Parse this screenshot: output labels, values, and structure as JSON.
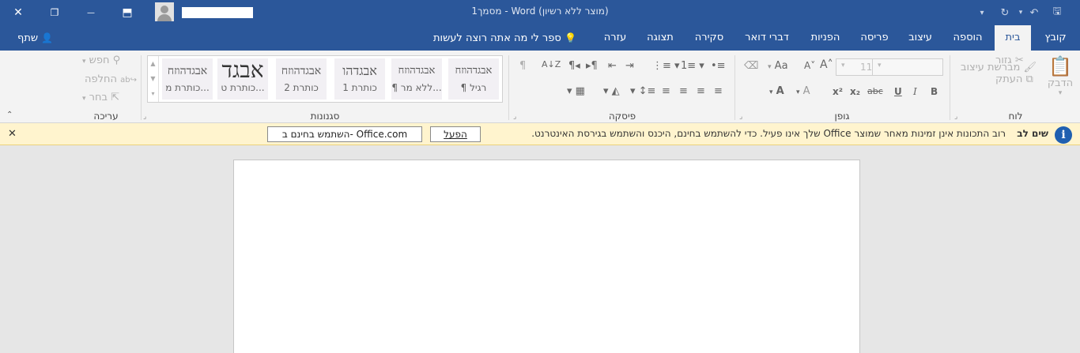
{
  "window": {
    "title": "מסמך1  -  Word (מוצר ללא רשיון)",
    "close_glyph": "✕",
    "restore_glyph": "❐",
    "minimize_glyph": "—",
    "ribbon_display_glyph": "⬒"
  },
  "qat": {
    "save_glyph": "🖫",
    "undo_glyph": "↶",
    "undo_dd": "▾",
    "redo_glyph": "↻",
    "customize_glyph": "▾"
  },
  "tabs": [
    {
      "label": "קובץ"
    },
    {
      "label": "בית"
    },
    {
      "label": "הוספה"
    },
    {
      "label": "עיצוב"
    },
    {
      "label": "פריסה"
    },
    {
      "label": "הפניות"
    },
    {
      "label": "דברי דואר"
    },
    {
      "label": "סקירה"
    },
    {
      "label": "תצוגה"
    },
    {
      "label": "עזרה"
    }
  ],
  "tell_me": {
    "label": "ספר לי מה אתה רוצה לעשות",
    "icon": "lightbulb-icon",
    "glyph": "💡"
  },
  "share": {
    "label": "שתף",
    "glyph": "👤"
  },
  "ribbon": {
    "groups": {
      "clipboard": "לוח",
      "font": "גופן",
      "paragraph": "פיסקה",
      "styles": "סגנונות",
      "editing": "עריכה"
    },
    "clipboard": {
      "paste": "הדבק",
      "cut": "גזור",
      "copy": "העתק",
      "format_painter": "מברשת עיצוב"
    },
    "font": {
      "size": "11",
      "grow": "A˄",
      "shrink": "A˅",
      "case": "Aa",
      "bold": "B",
      "italic": "I",
      "underline": "U",
      "strike": "abc",
      "subscript": "x₂",
      "superscript": "x²",
      "effects": "A",
      "color": "A"
    },
    "paragraph": {
      "pilcrow": "¶",
      "sort": "A↓Z"
    },
    "styles": [
      {
        "sample": "אבגדהוזח",
        "name": "¶ רגיל"
      },
      {
        "sample": "אבגדהוזח",
        "name": "¶ ללא מר..."
      },
      {
        "sample": "אבגדהו",
        "name": "כותרת 1"
      },
      {
        "sample": "אבגדהוזח",
        "name": "כותרת 2"
      },
      {
        "sample": "אבגד",
        "name": "כותרת ט..."
      },
      {
        "sample": "אבגדהוזח",
        "name": "כותרת מ..."
      }
    ],
    "editing": {
      "find": "חפש",
      "replace": "החלפה",
      "select": "בחר"
    }
  },
  "message_bar": {
    "title": "שים לב",
    "text": "רוב התכונות אינן זמינות מאחר שמוצר Office שלך אינו פעיל. כדי להשתמש בחינם, היכנס והשתמש בגירסת האינטרנט.",
    "activate_button": "הפעל",
    "free_button": "השתמש בחינם ב- Office.com",
    "close_glyph": "✕",
    "info_glyph": "i"
  }
}
